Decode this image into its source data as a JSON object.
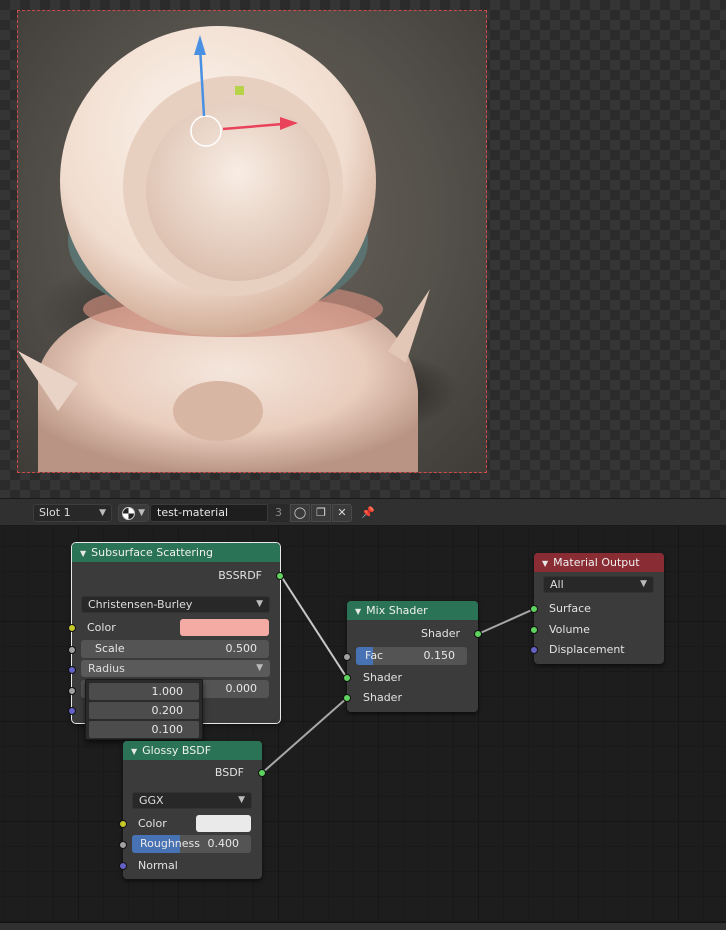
{
  "header": {
    "slot_label": "Slot 1",
    "material_name": "test-material",
    "user_count": "3"
  },
  "nodes": {
    "sss": {
      "title": "Subsurface Scattering",
      "output": "BSSRDF",
      "falloff": "Christensen-Burley",
      "color_label": "Color",
      "color": "#f4aba3",
      "scale_label": "Scale",
      "scale_value": "0.500",
      "radius_label": "Radius",
      "sharpness_value": "0.000",
      "radius_values": [
        "1.000",
        "0.200",
        "0.100"
      ]
    },
    "glossy": {
      "title": "Glossy BSDF",
      "output": "BSDF",
      "distribution": "GGX",
      "color_label": "Color",
      "color": "#eaeaea",
      "roughness_label": "Roughness",
      "roughness_value": "0.400",
      "roughness_fraction": 0.4,
      "normal_label": "Normal"
    },
    "mix": {
      "title": "Mix Shader",
      "output": "Shader",
      "fac_label": "Fac",
      "fac_value": "0.150",
      "fac_fraction": 0.15,
      "input1": "Shader",
      "input2": "Shader"
    },
    "output": {
      "title": "Material Output",
      "target": "All",
      "surface": "Surface",
      "volume": "Volume",
      "displacement": "Displacement"
    }
  },
  "colors": {
    "shader_socket": "#5fd35f",
    "color_socket": "#c7c729",
    "float_socket": "#a1a1a1",
    "vector_socket": "#6363c7",
    "shader_header": "#2b7356",
    "output_header": "#8a2c33",
    "gizmo_z": "#4a90e2",
    "gizmo_x": "#e8435a"
  }
}
